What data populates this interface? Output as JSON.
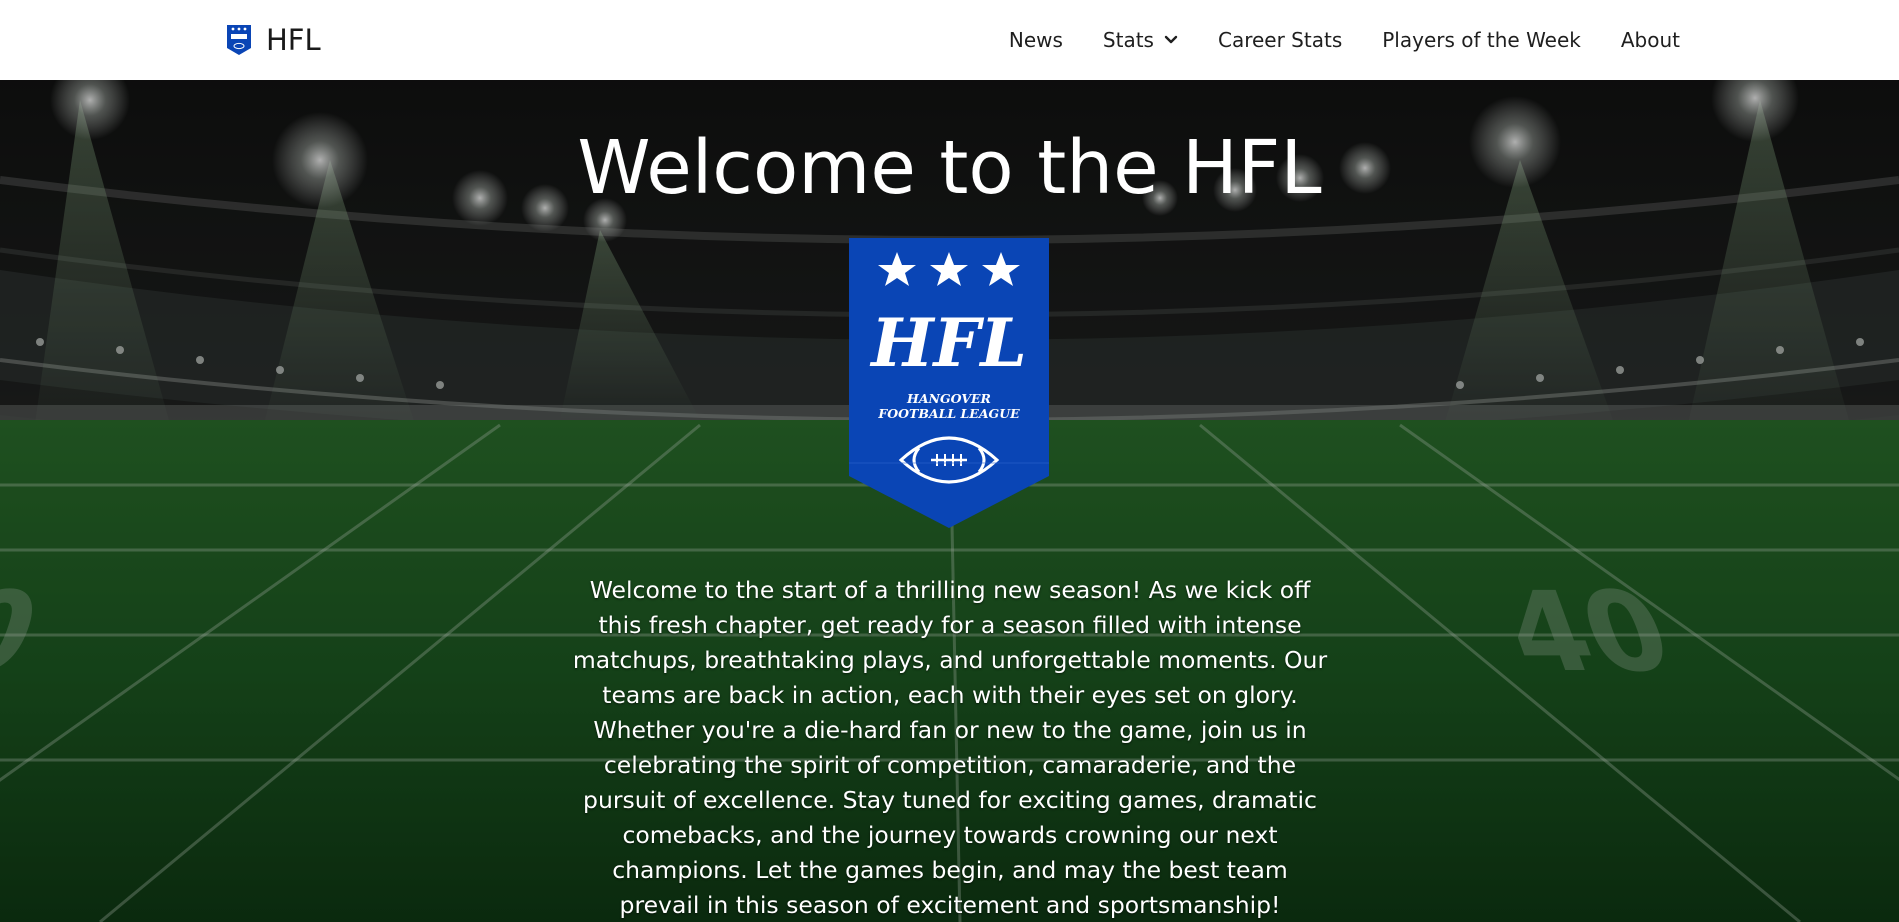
{
  "brand": {
    "name": "HFL",
    "icon": "hfl-shield-logo-icon"
  },
  "nav": {
    "items": [
      "News",
      "Stats",
      "Career Stats",
      "Players of the Week",
      "About"
    ],
    "dropdown_icon": "chevron-down-icon"
  },
  "hero": {
    "title": "Welcome to the HFL",
    "badge": {
      "text": "HFL",
      "subtitle_line1": "HANGOVER",
      "subtitle_line2": "FOOTBALL LEAGUE",
      "icons": [
        "star-icon",
        "star-icon",
        "star-icon",
        "football-icon"
      ]
    },
    "paragraph": "Welcome to the start of a thrilling new season! As we kick off this fresh chapter, get ready for a season filled with intense matchups, breathtaking plays, and unforgettable moments. Our teams are back in action, each with their eyes set on glory. Whether you're a die-hard fan or new to the game, join us in celebrating the spirit of competition, camaraderie, and the pursuit of excellence. Stay tuned for exciting games, dramatic comebacks, and the journey towards crowning our next champions. Let the games begin, and may the best team prevail in this season of excitement and sportsmanship!"
  },
  "colors": {
    "badge_blue": "#0a45b5",
    "navbar_bg": "#ffffff",
    "field_green": "#1f6b25",
    "nav_text": "#1f1f1f"
  }
}
